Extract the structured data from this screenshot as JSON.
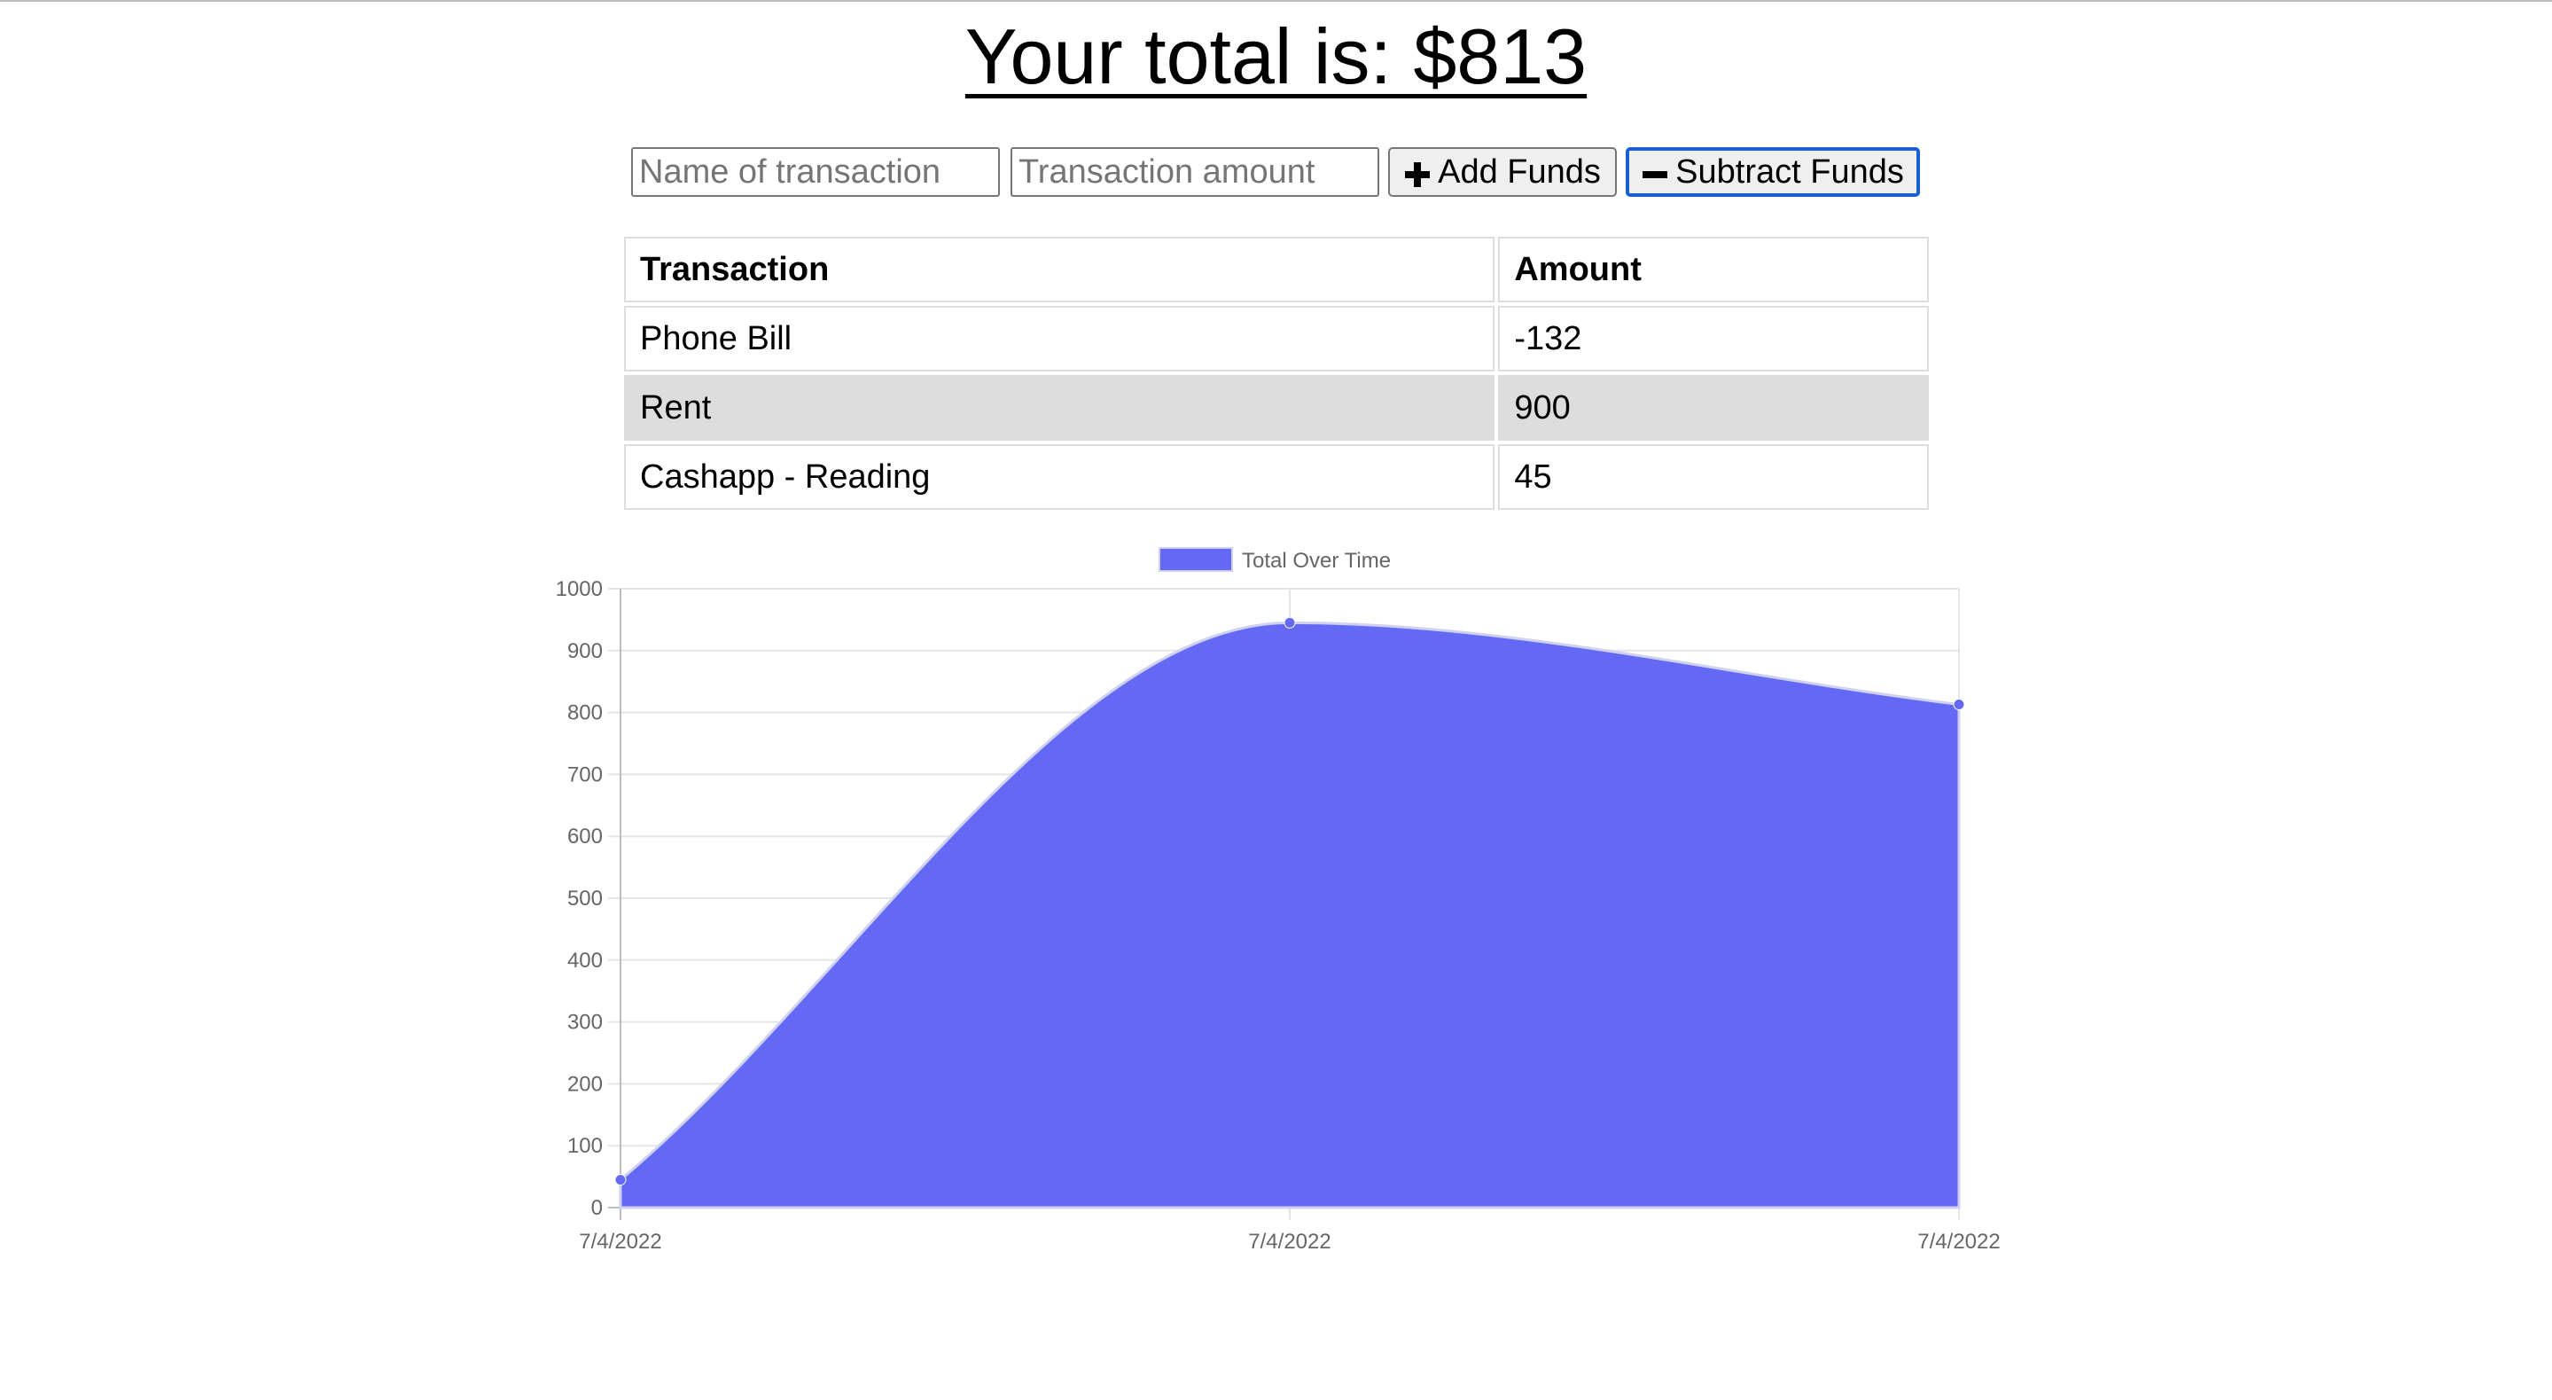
{
  "header": {
    "total_label": "Your total is: $813"
  },
  "form": {
    "name_placeholder": "Name of transaction",
    "amount_placeholder": "Transaction amount",
    "add_label": "Add Funds",
    "subtract_label": "Subtract Funds"
  },
  "table": {
    "headers": [
      "Transaction",
      "Amount"
    ],
    "rows": [
      [
        "Phone Bill",
        "-132"
      ],
      [
        "Rent",
        "900"
      ],
      [
        "Cashapp - Reading",
        "45"
      ]
    ]
  },
  "colors": {
    "fill": "#6369f5",
    "focus_ring": "#1a5fd0",
    "shaded_row": "#dddddd"
  },
  "chart_data": {
    "type": "area",
    "legend": {
      "label": "Total Over Time",
      "position": "top"
    },
    "x": [
      "7/4/2022",
      "7/4/2022",
      "7/4/2022"
    ],
    "series": [
      {
        "name": "Total Over Time",
        "values": [
          45,
          945,
          813
        ]
      }
    ],
    "ylim": [
      0,
      1000
    ],
    "yticks": [
      0,
      100,
      200,
      300,
      400,
      500,
      600,
      700,
      800,
      900,
      1000
    ],
    "grid": true
  }
}
